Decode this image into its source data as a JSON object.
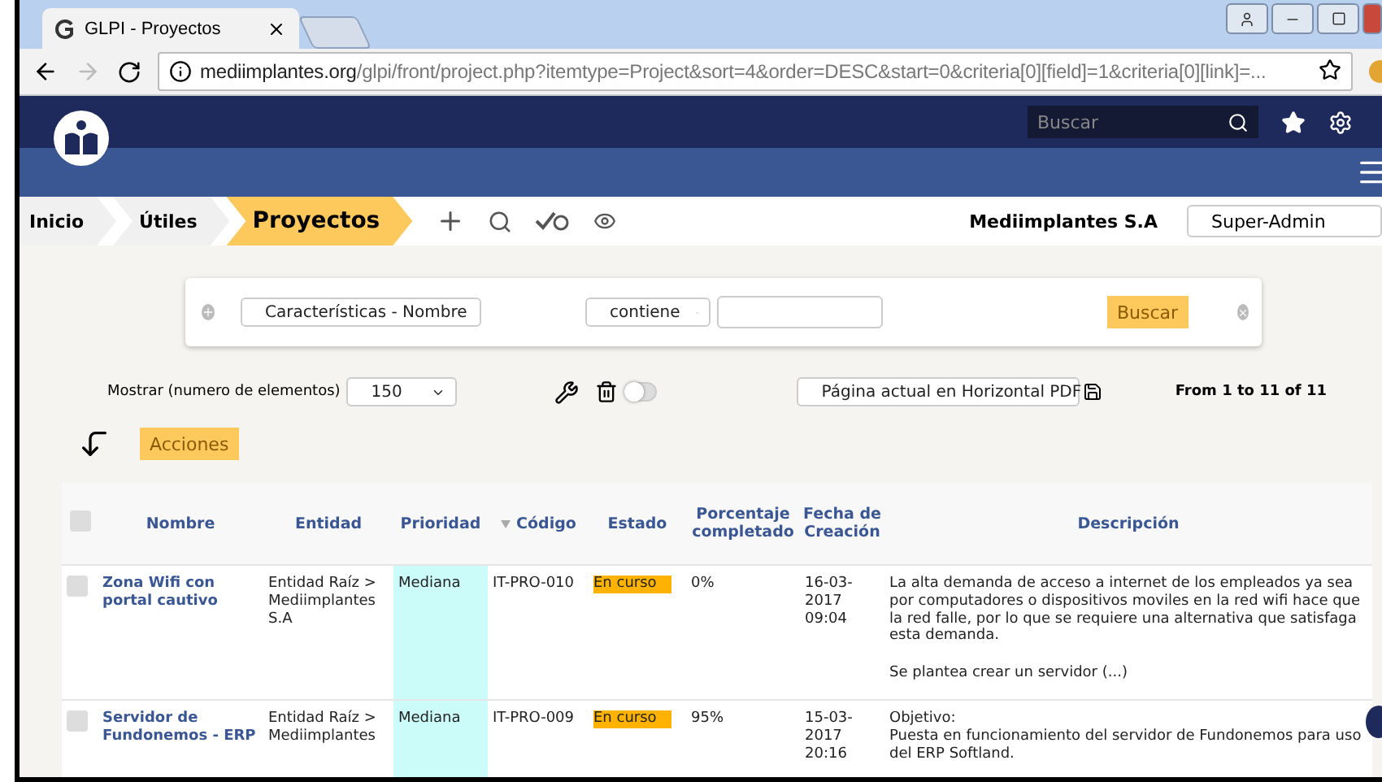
{
  "browser": {
    "tab_title": "GLPI - Proyectos",
    "url_host": "mediimplantes.org",
    "url_path": "/glpi/front/project.php?itemtype=Project&sort=4&order=DESC&start=0&criteria[0][field]=1&criteria[0][link]=..."
  },
  "header": {
    "search_placeholder": "Buscar"
  },
  "breadcrumb": [
    {
      "label": "Inicio",
      "selected": false
    },
    {
      "label": "Útiles",
      "selected": false
    },
    {
      "label": "Proyectos",
      "selected": true
    }
  ],
  "entity": "Mediimplantes S.A",
  "profile": "Super-Admin",
  "search": {
    "field": "Características - Nombre",
    "operator": "contiene",
    "button": "Buscar"
  },
  "list_controls": {
    "show_label": "Mostrar (numero de elementos)",
    "show_value": "150",
    "bulk_toggle_on": false,
    "export": "Página actual en Horizontal PDF",
    "pager": "From 1 to 11 of 11",
    "actions": "Acciones"
  },
  "table": {
    "select_all_checked": false,
    "columns": [
      {
        "label": "Nombre",
        "sorted": false
      },
      {
        "label": "Entidad",
        "sorted": false
      },
      {
        "label": "Prioridad",
        "sorted": false
      },
      {
        "label": "Código",
        "sorted": true
      },
      {
        "label": "Estado",
        "sorted": false
      },
      {
        "label": "Porcentaje completado",
        "sorted": false
      },
      {
        "label": "Fecha de Creación",
        "sorted": false
      },
      {
        "label": "Descripción",
        "sorted": false
      }
    ],
    "rows": [
      {
        "checked": false,
        "name": "Zona Wifi con portal cautivo",
        "entity": "Entidad Raíz > Mediimplantes S.A",
        "priority": "Mediana",
        "code": "IT-PRO-010",
        "status": "En curso",
        "percent": "0%",
        "date": "16-03-2017 09:04",
        "description": [
          "La alta demanda de acceso a internet de los empleados ya sea por computadores o dispositivos moviles en la red wifi hace que la red falle, por lo que se requiere una alternativa que satisfaga esta demanda.",
          "Se plantea crear un servidor  (...)"
        ]
      },
      {
        "checked": false,
        "name": "Servidor de Fundonemos - ERP",
        "entity": "Entidad Raíz > Mediimplantes",
        "priority": "Mediana",
        "code": "IT-PRO-009",
        "status": "En curso",
        "percent": "95%",
        "date": "15-03-2017 20:16",
        "description": [
          "Objetivo:\nPuesta en funcionamiento del servidor de Fundonemos para uso del ERP Softland."
        ]
      }
    ]
  }
}
